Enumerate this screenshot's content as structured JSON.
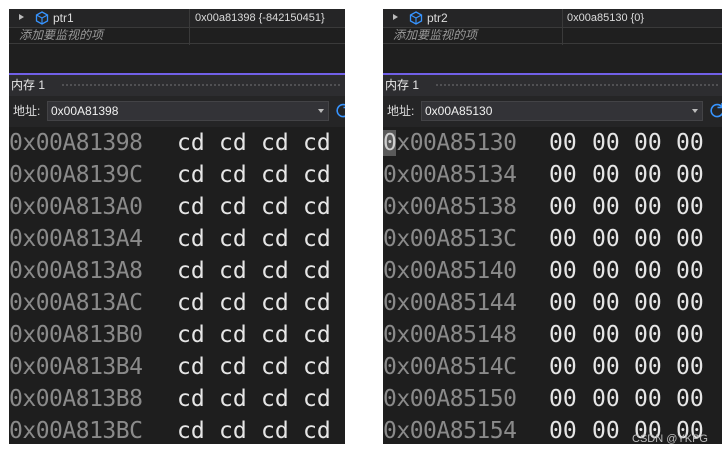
{
  "panels": [
    {
      "watch": {
        "name": "ptr1",
        "value": "0x00a81398 {-842150451}",
        "add_hint": "添加要监视的项"
      },
      "memory": {
        "title": "内存 1",
        "address_label": "地址:",
        "address_value": "0x00A81398",
        "rows": [
          {
            "addr": "0x00A81398",
            "bytes": [
              "cd",
              "cd",
              "cd",
              "cd"
            ]
          },
          {
            "addr": "0x00A8139C",
            "bytes": [
              "cd",
              "cd",
              "cd",
              "cd"
            ]
          },
          {
            "addr": "0x00A813A0",
            "bytes": [
              "cd",
              "cd",
              "cd",
              "cd"
            ]
          },
          {
            "addr": "0x00A813A4",
            "bytes": [
              "cd",
              "cd",
              "cd",
              "cd"
            ]
          },
          {
            "addr": "0x00A813A8",
            "bytes": [
              "cd",
              "cd",
              "cd",
              "cd"
            ]
          },
          {
            "addr": "0x00A813AC",
            "bytes": [
              "cd",
              "cd",
              "cd",
              "cd"
            ]
          },
          {
            "addr": "0x00A813B0",
            "bytes": [
              "cd",
              "cd",
              "cd",
              "cd"
            ]
          },
          {
            "addr": "0x00A813B4",
            "bytes": [
              "cd",
              "cd",
              "cd",
              "cd"
            ]
          },
          {
            "addr": "0x00A813B8",
            "bytes": [
              "cd",
              "cd",
              "cd",
              "cd"
            ]
          },
          {
            "addr": "0x00A813BC",
            "bytes": [
              "cd",
              "cd",
              "cd",
              "cd"
            ]
          }
        ]
      }
    },
    {
      "watch": {
        "name": "ptr2",
        "value": "0x00a85130 {0}",
        "add_hint": "添加要监视的项"
      },
      "memory": {
        "title": "内存 1",
        "address_label": "地址:",
        "address_value": "0x00A85130",
        "rows": [
          {
            "addr": "0x00A85130",
            "bytes": [
              "00",
              "00",
              "00",
              "00"
            ]
          },
          {
            "addr": "0x00A85134",
            "bytes": [
              "00",
              "00",
              "00",
              "00"
            ]
          },
          {
            "addr": "0x00A85138",
            "bytes": [
              "00",
              "00",
              "00",
              "00"
            ]
          },
          {
            "addr": "0x00A8513C",
            "bytes": [
              "00",
              "00",
              "00",
              "00"
            ]
          },
          {
            "addr": "0x00A85140",
            "bytes": [
              "00",
              "00",
              "00",
              "00"
            ]
          },
          {
            "addr": "0x00A85144",
            "bytes": [
              "00",
              "00",
              "00",
              "00"
            ]
          },
          {
            "addr": "0x00A85148",
            "bytes": [
              "00",
              "00",
              "00",
              "00"
            ]
          },
          {
            "addr": "0x00A8514C",
            "bytes": [
              "00",
              "00",
              "00",
              "00"
            ]
          },
          {
            "addr": "0x00A85150",
            "bytes": [
              "00",
              "00",
              "00",
              "00"
            ]
          },
          {
            "addr": "0x00A85154",
            "bytes": [
              "00",
              "00",
              "00",
              "00"
            ]
          }
        ]
      }
    }
  ],
  "credit": "CSDN @YKPG",
  "colors": {
    "accent": "#7160e8",
    "background": "#1e1e1e",
    "address_text": "#8a8a8a",
    "byte_text": "#e6e6e6",
    "icon_blue": "#3794ff"
  },
  "icons": {
    "watch_item": "variable-cube-icon",
    "expand": "expand-triangle-icon",
    "dropdown": "chevron-down-icon",
    "refresh": "refresh-icon"
  }
}
